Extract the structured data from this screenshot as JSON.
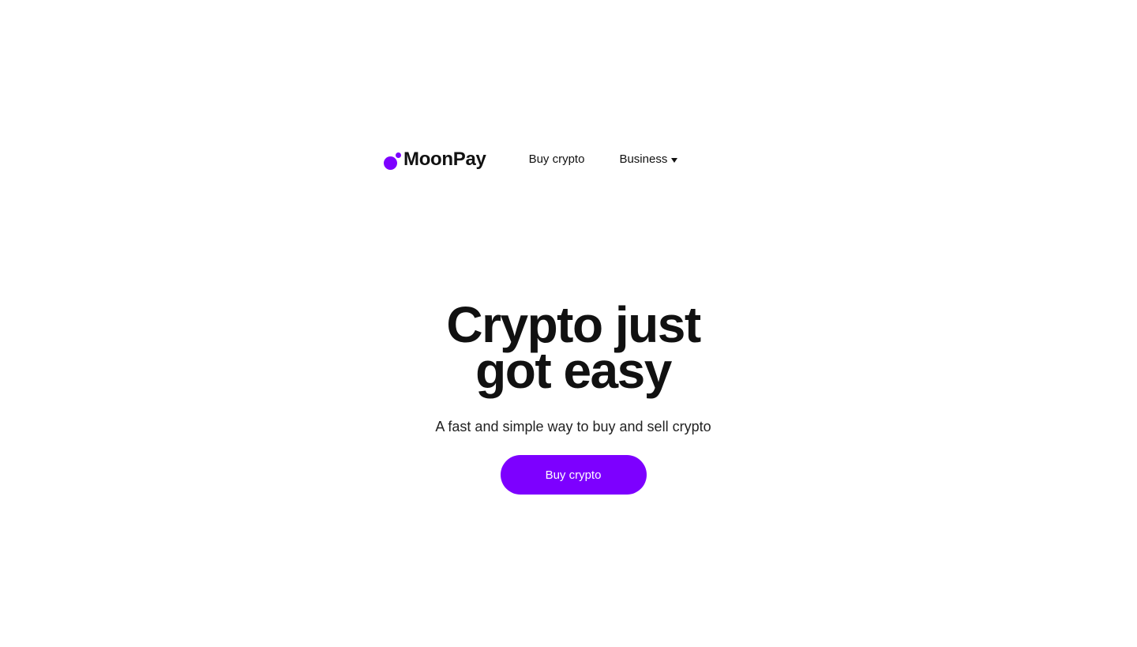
{
  "brand": {
    "name": "MoonPay",
    "accent_color": "#7D00FF",
    "logo_icon": "moonpay-logo-icon"
  },
  "nav": {
    "items": [
      {
        "label": "Buy crypto"
      },
      {
        "label": "Business",
        "icon": "caret-down-icon"
      }
    ]
  },
  "hero": {
    "title_line1": "Crypto just",
    "title_line2": "got easy",
    "subtitle": "A fast and simple way to buy and sell crypto",
    "cta_label": "Buy crypto"
  }
}
